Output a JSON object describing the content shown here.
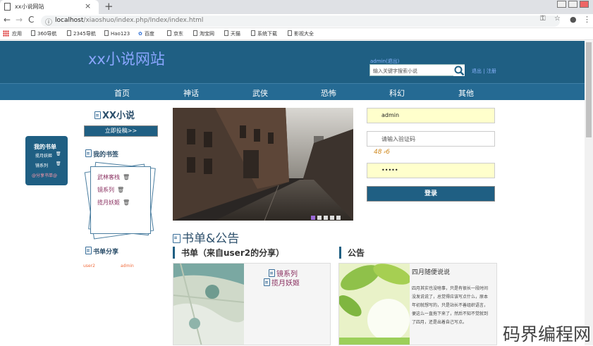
{
  "browser": {
    "tab_title": "xx小说网站",
    "tab_close": "×",
    "new_tab": "+",
    "nav_back": "←",
    "nav_forward": "→",
    "nav_reload": "C",
    "url_host": "localhost",
    "url_path": "/xiaoshuo/index.php/Index/index.html",
    "bookmarks": [
      "应用",
      "360导航",
      "2345导航",
      "Hao123",
      "百度",
      "京东",
      "淘宝网",
      "天猫",
      "系统下载",
      "影视大全"
    ]
  },
  "header": {
    "logo": "xx小说网站",
    "user_link": "admin(退出)",
    "search_placeholder": "输入关键字搜索小说",
    "logout": "退出",
    "register": "注册",
    "separator": "|"
  },
  "nav": [
    "首页",
    "神话",
    "武侠",
    "恐怖",
    "科幻",
    "其他"
  ],
  "float_shelf": {
    "title": "我的书单",
    "items": [
      "揽月妖姬",
      "镜系列"
    ],
    "share": "@分享书单@",
    "delete_icon": "trash-icon"
  },
  "sidebar": {
    "site_title": "XX小说",
    "post_button": "立即投稿>>",
    "bookmarks_title": "我的书签",
    "bookmarks": [
      "武林客栈",
      "镜系列",
      "揽月妖姬"
    ],
    "share_title": "书单分享",
    "share_users": [
      "user2",
      "admin"
    ]
  },
  "carousel": {
    "slides": 5,
    "active": 1
  },
  "login": {
    "username": "admin",
    "captcha_placeholder": "请输入验证码",
    "captcha_text": "48 ⸗6",
    "password": "•••••",
    "login_button": "登录"
  },
  "booklist": {
    "title": "书单&公告",
    "sub_title": "书单（来自user2的分享）",
    "books": [
      "镜系列",
      "揽月妖姬"
    ]
  },
  "notice": {
    "title": "公告",
    "post_title": "四月随便说说",
    "post_body": "四月其实也没啥事，只是有很长一段时间没发说说了，总觉得应该写点什么，原本年初就想写的，只是站长不善组织语言，便这么一直拖下来了，然后不知不觉就到了四月，还是出着自己写点。"
  },
  "watermark": "码界编程网",
  "colors": {
    "header": "#1f5f83",
    "nav": "#256a93",
    "accent_link": "#8a3060",
    "input_fill": "#ffffcc"
  }
}
